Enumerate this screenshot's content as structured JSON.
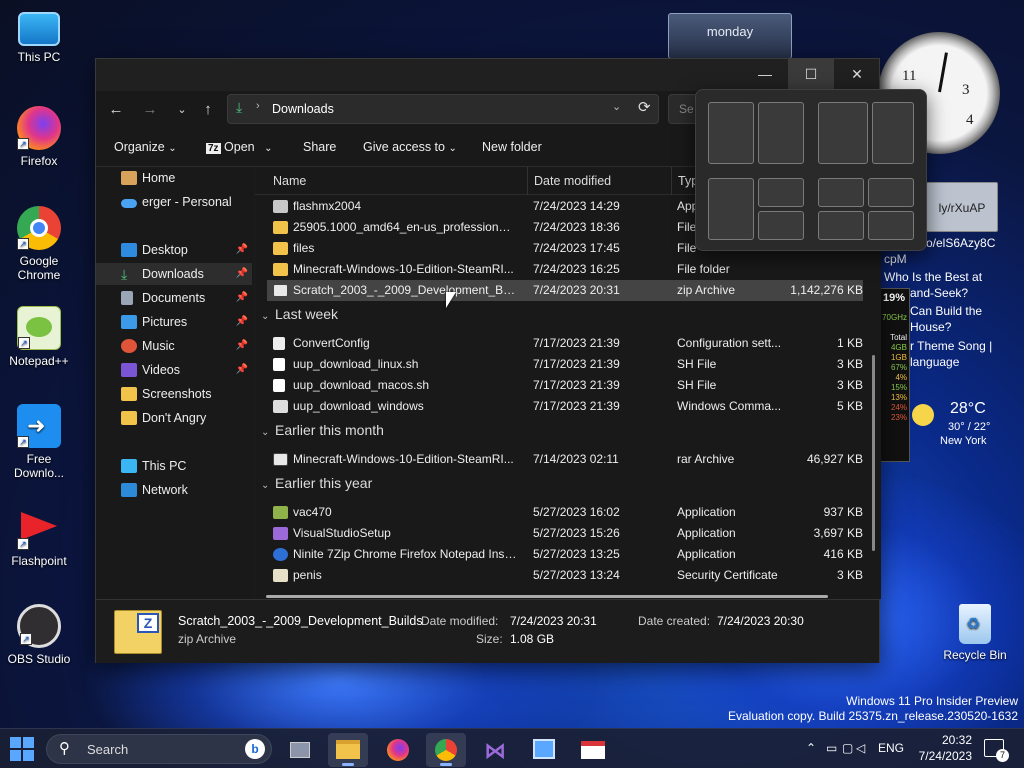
{
  "desktop": {
    "icons": [
      {
        "label": "This PC"
      },
      {
        "label": "Firefox"
      },
      {
        "label": "Google Chrome"
      },
      {
        "label": "Notepad++"
      },
      {
        "label": "Free Downlo..."
      },
      {
        "label": "Flashpoint"
      },
      {
        "label": "OBS Studio"
      }
    ],
    "recycle_bin": "Recycle Bin",
    "watermark_line1": "Windows 11 Pro Insider Preview",
    "watermark_line2": "Evaluation copy. Build 25375.zn_release.230520-1632"
  },
  "widgets": {
    "calendar_day": "monday",
    "feed_link1": "ly/rXuAP",
    "feed_link2": "o/elS6Azy8C",
    "feed_items": [
      "cpM",
      "Who Is the Best at",
      "and-Seek?",
      "Can Build the",
      "House?",
      "r Theme Song |",
      "language"
    ],
    "cpu_percent": "19%",
    "cpu_freq": "70GHz",
    "mem_label": "Total",
    "mem_values": [
      "4GB",
      "1GB",
      "67%",
      "4%",
      "15%",
      "13%",
      "24%",
      "23%"
    ],
    "weather_temp": "28°C",
    "weather_range": "30° / 22°",
    "weather_city": "New York"
  },
  "explorer": {
    "window_controls": {
      "minimize": "—",
      "maximize": "☐",
      "close": "✕"
    },
    "address": {
      "path": "Downloads"
    },
    "search_placeholder": "Se",
    "toolbar": {
      "organize": "Organize",
      "open": "Open",
      "share": "Share",
      "give_access": "Give access to",
      "new_folder": "New folder"
    },
    "sidebar": {
      "items": [
        {
          "label": "Home"
        },
        {
          "label": "erger - Personal"
        },
        {
          "label": "Desktop"
        },
        {
          "label": "Downloads"
        },
        {
          "label": "Documents"
        },
        {
          "label": "Pictures"
        },
        {
          "label": "Music"
        },
        {
          "label": "Videos"
        },
        {
          "label": "Screenshots"
        },
        {
          "label": "Don't Angry"
        },
        {
          "label": "This PC"
        },
        {
          "label": "Network"
        }
      ]
    },
    "columns": {
      "name": "Name",
      "date": "Date modified",
      "type": "Typ"
    },
    "groups": {
      "last_week": "Last week",
      "earlier_month": "Earlier this month",
      "earlier_year": "Earlier this year"
    },
    "files": [
      {
        "name": "flashmx2004",
        "date": "7/24/2023 14:29",
        "type": "App",
        "size": ""
      },
      {
        "name": "25905.1000_amd64_en-us_professional_1...",
        "date": "7/24/2023 18:36",
        "type": "File",
        "size": ""
      },
      {
        "name": "files",
        "date": "7/24/2023 17:45",
        "type": "File",
        "size": ""
      },
      {
        "name": "Minecraft-Windows-10-Edition-SteamRI...",
        "date": "7/24/2023 16:25",
        "type": "File folder",
        "size": ""
      },
      {
        "name": "Scratch_2003_-_2009_Development_Builds",
        "date": "7/24/2023 20:31",
        "type": "zip Archive",
        "size": "1,142,276 KB"
      },
      {
        "name": "ConvertConfig",
        "date": "7/17/2023 21:39",
        "type": "Configuration sett...",
        "size": "1 KB"
      },
      {
        "name": "uup_download_linux.sh",
        "date": "7/17/2023 21:39",
        "type": "SH File",
        "size": "3 KB"
      },
      {
        "name": "uup_download_macos.sh",
        "date": "7/17/2023 21:39",
        "type": "SH File",
        "size": "3 KB"
      },
      {
        "name": "uup_download_windows",
        "date": "7/17/2023 21:39",
        "type": "Windows Comma...",
        "size": "5 KB"
      },
      {
        "name": "Minecraft-Windows-10-Edition-SteamRI...",
        "date": "7/14/2023 02:11",
        "type": "rar Archive",
        "size": "46,927 KB"
      },
      {
        "name": "vac470",
        "date": "5/27/2023 16:02",
        "type": "Application",
        "size": "937 KB"
      },
      {
        "name": "VisualStudioSetup",
        "date": "5/27/2023 15:26",
        "type": "Application",
        "size": "3,697 KB"
      },
      {
        "name": "Ninite 7Zip Chrome Firefox Notepad Inst...",
        "date": "5/27/2023 13:25",
        "type": "Application",
        "size": "416 KB"
      },
      {
        "name": "penis",
        "date": "5/27/2023 13:24",
        "type": "Security Certificate",
        "size": "3 KB"
      }
    ],
    "details": {
      "name": "Scratch_2003_-_2009_Development_Builds",
      "type": "zip Archive",
      "modified_label": "Date modified:",
      "modified_value": "7/24/2023 20:31",
      "created_label": "Date created:",
      "created_value": "7/24/2023 20:30",
      "size_label": "Size:",
      "size_value": "1.08 GB"
    }
  },
  "taskbar": {
    "search_placeholder": "Search",
    "language": "ENG",
    "time": "20:32",
    "date": "7/24/2023",
    "notifications": "7"
  },
  "colors": {
    "accent": "#4cc2ff",
    "folder": "#f2c34a",
    "window_bg": "#191919"
  }
}
